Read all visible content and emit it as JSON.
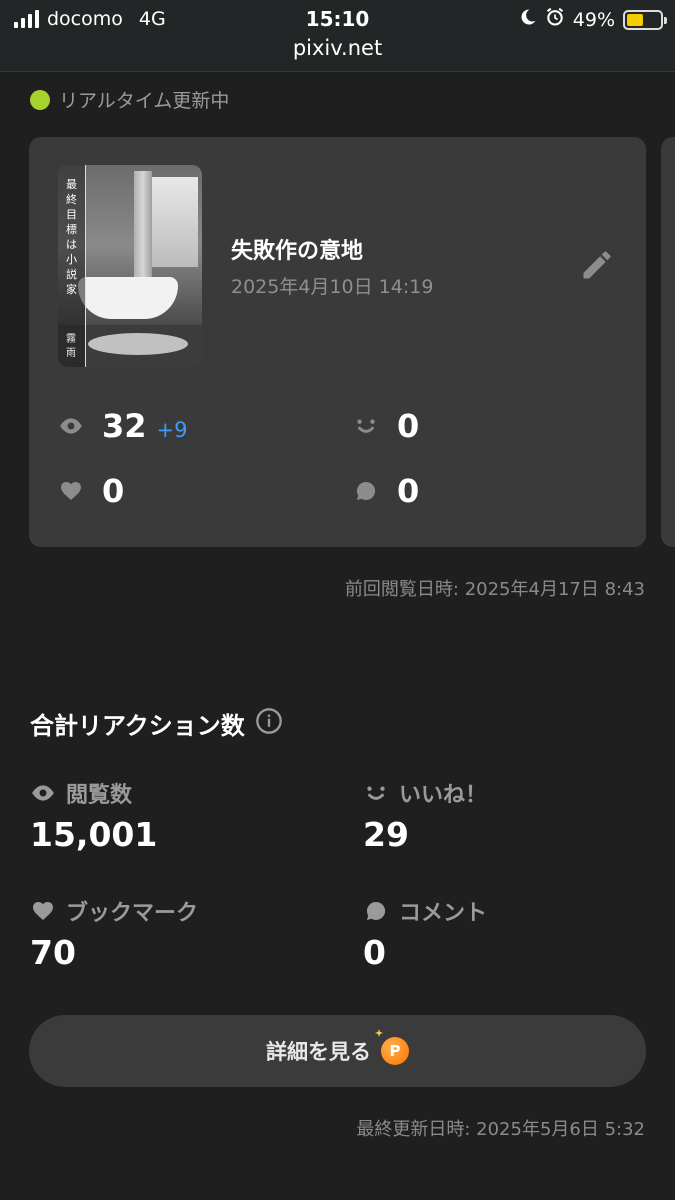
{
  "status_bar": {
    "carrier": "docomo",
    "network": "4G",
    "time": "15:10",
    "url": "pixiv.net",
    "battery": "49%",
    "battery_level": 0.49
  },
  "realtime_label": "リアルタイム更新中",
  "work": {
    "cover_title": "最終目標は小説家",
    "cover_author": "霧雨",
    "title": "失敗作の意地",
    "date": "2025年4月10日 14:19",
    "views": "32",
    "views_delta": "+9",
    "likes": "0",
    "bookmarks": "0",
    "comments": "0"
  },
  "last_viewed": "前回閲覧日時: 2025年4月17日 8:43",
  "totals": {
    "title": "合計リアクション数",
    "views_label": "閲覧数",
    "views": "15,001",
    "likes_label": "いいね！",
    "likes": "29",
    "bookmarks_label": "ブックマーク",
    "bookmarks": "70",
    "comments_label": "コメント",
    "comments": "0"
  },
  "detail_button": "詳細を見る",
  "last_updated": "最終更新日時: 2025年5月6日 5:32",
  "colors": {
    "background": "#1f1f1f",
    "card": "#3a3a3a",
    "realtime_dot": "#a7d22c",
    "delta": "#3d9bff",
    "point_badge": "#ff7300"
  }
}
